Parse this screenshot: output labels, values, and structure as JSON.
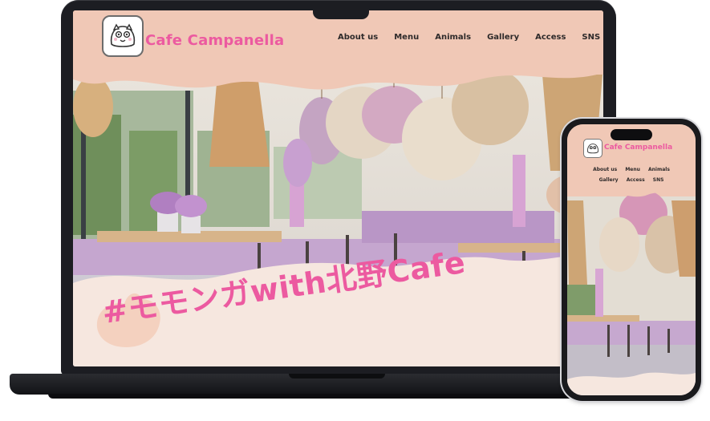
{
  "site": {
    "brand": "Cafe Campanella",
    "nav": [
      "About us",
      "Menu",
      "Animals",
      "Gallery",
      "Access",
      "SNS"
    ],
    "hero_banner": "#モモンガwith北野Cafe"
  },
  "phone": {
    "brand": "Cafe Campanella",
    "nav_row1": [
      "About us",
      "Menu",
      "Animals"
    ],
    "nav_row2": [
      "Gallery",
      "Access",
      "SNS"
    ]
  },
  "colors": {
    "accent_pink": "#ec5aa0",
    "header_peach": "#f0c8b6",
    "banner_cream": "#f6e7df",
    "device_dark": "#1c1d22"
  },
  "icons": [
    "flying-squirrel-logo-icon"
  ]
}
